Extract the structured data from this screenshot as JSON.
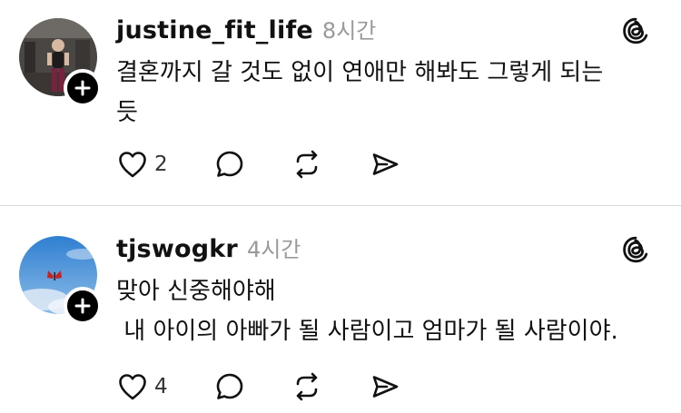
{
  "posts": [
    {
      "username": "justine_fit_life",
      "time": "8시간",
      "lines": [
        "결혼까지 갈 것도 없이 연애만 해봐도 그렇게 되는",
        "듯"
      ],
      "like_count": "2",
      "avatar_icon": "gym-photo-avatar",
      "badge_icon": "plus-icon",
      "brand_icon": "threads-logo-icon"
    },
    {
      "username": "tjswogkr",
      "time": "4시간",
      "lines": [
        "맞아 신중해야해",
        " 내 아이의 아빠가 될 사람이고 엄마가 될 사람이야."
      ],
      "like_count": "4",
      "avatar_icon": "sky-butterfly-avatar",
      "badge_icon": "plus-icon",
      "brand_icon": "threads-logo-icon"
    }
  ],
  "action_icons": [
    "heart-icon",
    "comment-icon",
    "repost-icon",
    "share-icon"
  ],
  "colors": {
    "text": "#111111",
    "muted": "#9a9a9a",
    "divider": "#d9d9d9",
    "badge": "#000000"
  }
}
